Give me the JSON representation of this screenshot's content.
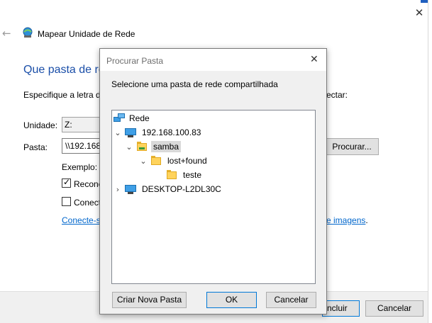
{
  "wizard": {
    "title": "Mapear Unidade de Rede",
    "heading": "Que pasta de re",
    "specify_text": "Especifique a letra de",
    "specify_tail": "ectar:",
    "drive_label": "Unidade:",
    "drive_value": "Z:",
    "folder_label": "Pasta:",
    "folder_value": "\\\\192.168",
    "browse_button": "Procurar...",
    "example_text": "Exemplo: \\",
    "reconnect_label": "Reconec",
    "reconnect_checked": true,
    "credentials_label": "Conect",
    "credentials_checked": false,
    "link_left": "Conecte-s",
    "link_right_link": "e imagens",
    "link_right_tail": ".",
    "finish_button": "ncluir",
    "cancel_button": "Cancelar"
  },
  "dialog": {
    "title": "Procurar Pasta",
    "prompt": "Selecione uma pasta de rede compartilhada",
    "tree": {
      "root": "Rede",
      "host1": "192.168.100.83",
      "share": "samba",
      "folder": "lost+found",
      "subfolder": "teste",
      "host2": "DESKTOP-L2DL30C"
    },
    "new_folder_button": "Criar Nova Pasta",
    "ok_button": "OK",
    "cancel_button": "Cancelar"
  },
  "colors": {
    "heading": "#1a4ea8",
    "link": "#0066cc",
    "accent_border": "#0078d7",
    "selection": "#d9d9d9"
  },
  "icons": [
    "back-arrow-icon",
    "network-drive-icon",
    "close-icon",
    "network-icon",
    "computer-icon",
    "folder-icon",
    "shared-folder-icon",
    "chevron-down-icon",
    "chevron-right-icon",
    "checkmark-icon"
  ]
}
